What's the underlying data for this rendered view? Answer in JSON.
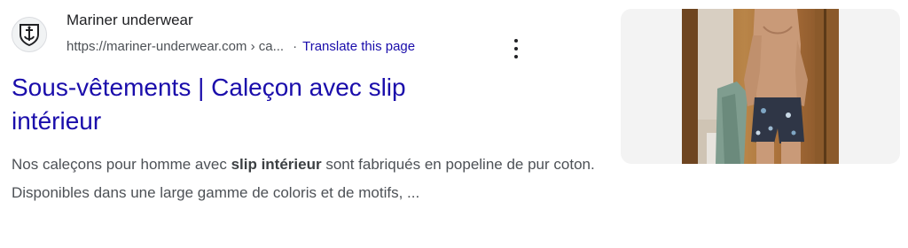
{
  "site": {
    "name": "Mariner underwear",
    "url": "https://mariner-underwear.com › ca...",
    "separator": "·",
    "translate": "Translate this page"
  },
  "title": {
    "line1": "Sous-vêtements | Caleçon avec slip",
    "line2": "intérieur"
  },
  "snippet": {
    "before": "Nos caleçons pour homme avec ",
    "bold": "slip intérieur",
    "after": " sont fabriqués en popeline de pur coton. Disponibles dans une large gamme de coloris et de motifs, ..."
  },
  "icons": {
    "favicon": "shield-anchor-icon",
    "more": "more-vert-icon"
  },
  "colors": {
    "link": "#1a0dab",
    "text": "#4d5156",
    "site_name": "#202124"
  }
}
